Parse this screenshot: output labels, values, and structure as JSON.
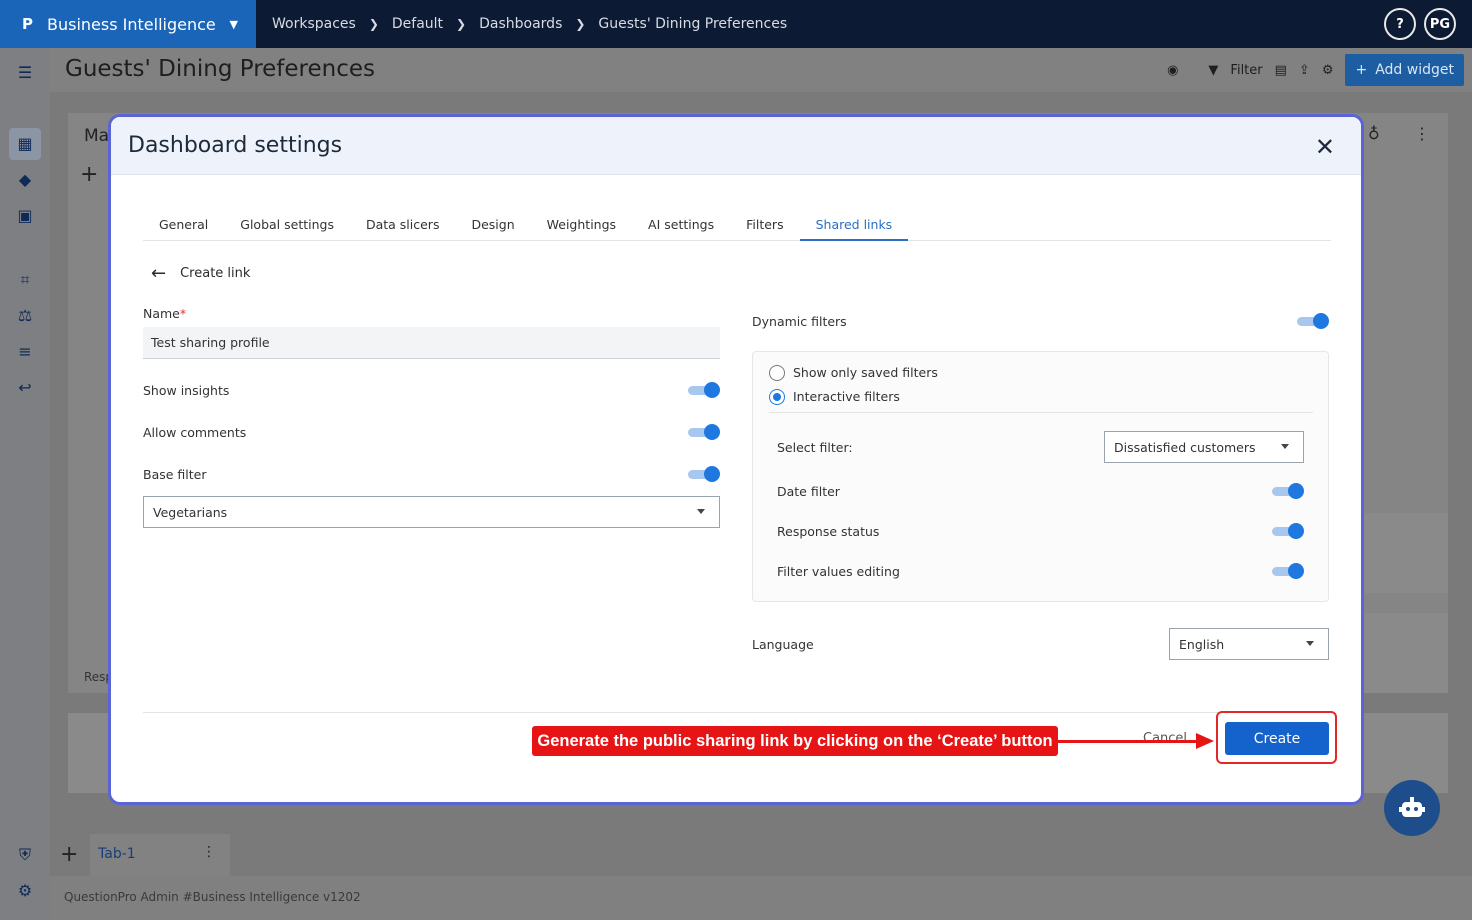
{
  "topbar": {
    "app_name": "Business Intelligence",
    "breadcrumbs": [
      "Workspaces",
      "Default",
      "Dashboards",
      "Guests' Dining Preferences"
    ],
    "help_label": "?",
    "avatar_initials": "PG"
  },
  "header": {
    "title": "Guests' Dining Preferences",
    "filter_label": "Filter",
    "add_widget_label": "Add widget"
  },
  "background": {
    "widget_title_fragment": "Ma",
    "widget_footer_fragment": "Resp"
  },
  "modal": {
    "title": "Dashboard settings",
    "tabs": [
      {
        "label": "General",
        "selected": false
      },
      {
        "label": "Global settings",
        "selected": false
      },
      {
        "label": "Data slicers",
        "selected": false
      },
      {
        "label": "Design",
        "selected": false
      },
      {
        "label": "Weightings",
        "selected": false
      },
      {
        "label": "AI settings",
        "selected": false
      },
      {
        "label": "Filters",
        "selected": false
      },
      {
        "label": "Shared links",
        "selected": true
      }
    ],
    "back_label": "Create link",
    "name_label": "Name",
    "name_required": "*",
    "name_value": "Test sharing profile",
    "show_insights_label": "Show insights",
    "show_insights_on": true,
    "allow_comments_label": "Allow comments",
    "allow_comments_on": true,
    "base_filter_label": "Base filter",
    "base_filter_on": true,
    "base_filter_value": "Vegetarians",
    "dynamic_filters_label": "Dynamic filters",
    "dynamic_filters_on": true,
    "radio_saved_label": "Show only saved filters",
    "radio_interactive_label": "Interactive filters",
    "selected_radio": "interactive",
    "select_filter_label": "Select filter:",
    "select_filter_value": "Dissatisfied customers",
    "date_filter_label": "Date filter",
    "response_status_label": "Response status",
    "filter_values_editing_label": "Filter values editing",
    "language_label": "Language",
    "language_value": "English",
    "cancel_label": "Cancel",
    "create_label": "Create"
  },
  "annotation": {
    "text": "Generate the public sharing link by clicking on the ‘Create’ button"
  },
  "tabbar": {
    "tab_label": "Tab-1"
  },
  "footer": {
    "prefix": "QuestionPro Admin ",
    "link": "#Business Intelligence v1202"
  },
  "colors": {
    "accent": "#1f78e0",
    "brand": "#1a65b8",
    "topbar": "#0c1a33",
    "annotation": "#e61414",
    "modal_border": "#5a64d8"
  }
}
